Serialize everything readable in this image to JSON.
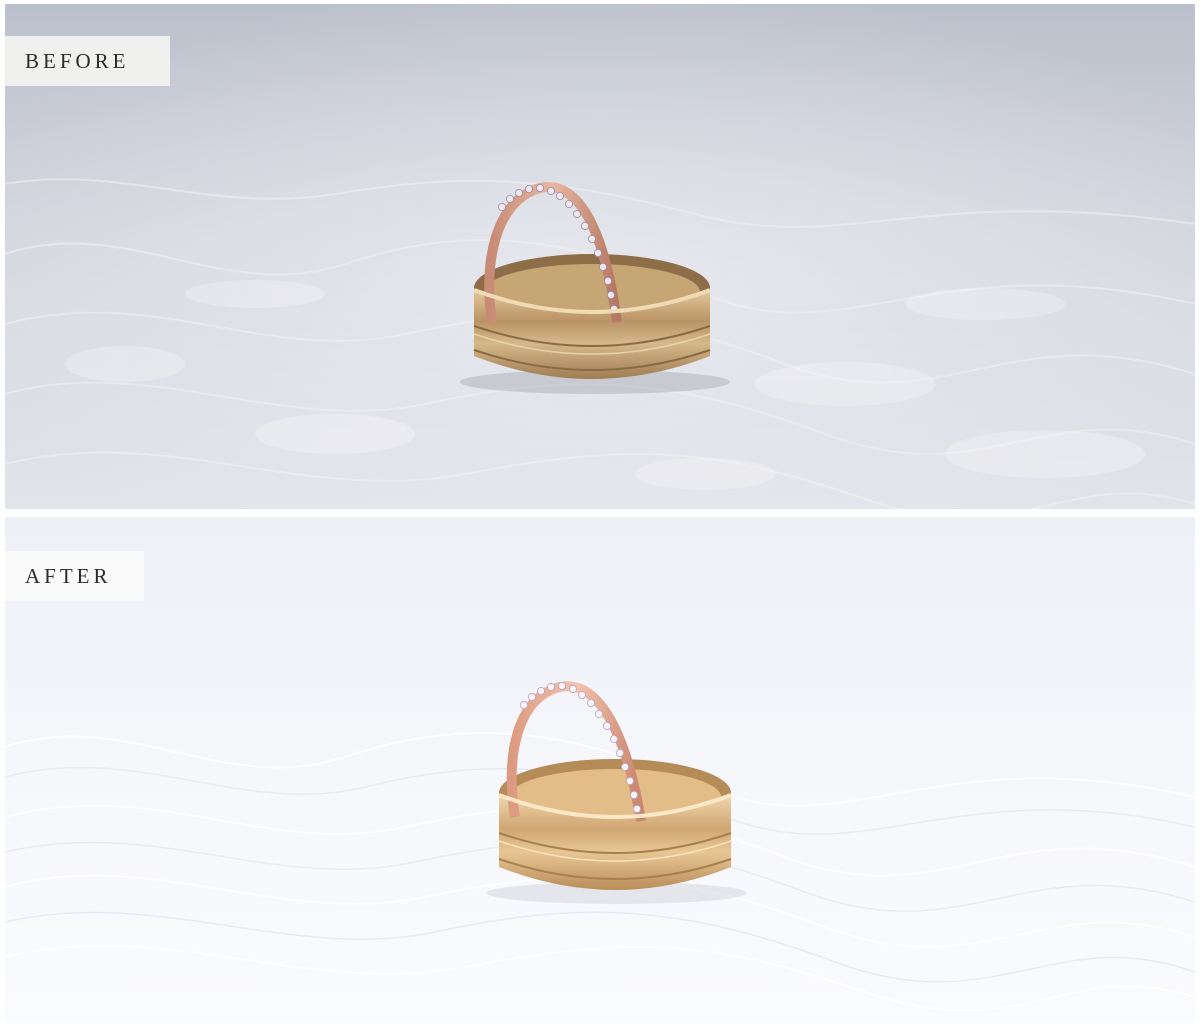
{
  "panels": {
    "before": {
      "label": "BEFORE",
      "tone": {
        "background_top": "#bfc3cf",
        "background_bottom": "#e4e5ea",
        "lace": "#f4f4f6",
        "gold_band": "#c9a97a",
        "rose_band": "#d59d82"
      }
    },
    "after": {
      "label": "AFTER",
      "tone": {
        "background_top": "#f1f3f8",
        "background_bottom": "#fbfbfd",
        "lace": "#ffffff",
        "gold_band": "#dcb483",
        "rose_band": "#e7a98c"
      }
    }
  }
}
